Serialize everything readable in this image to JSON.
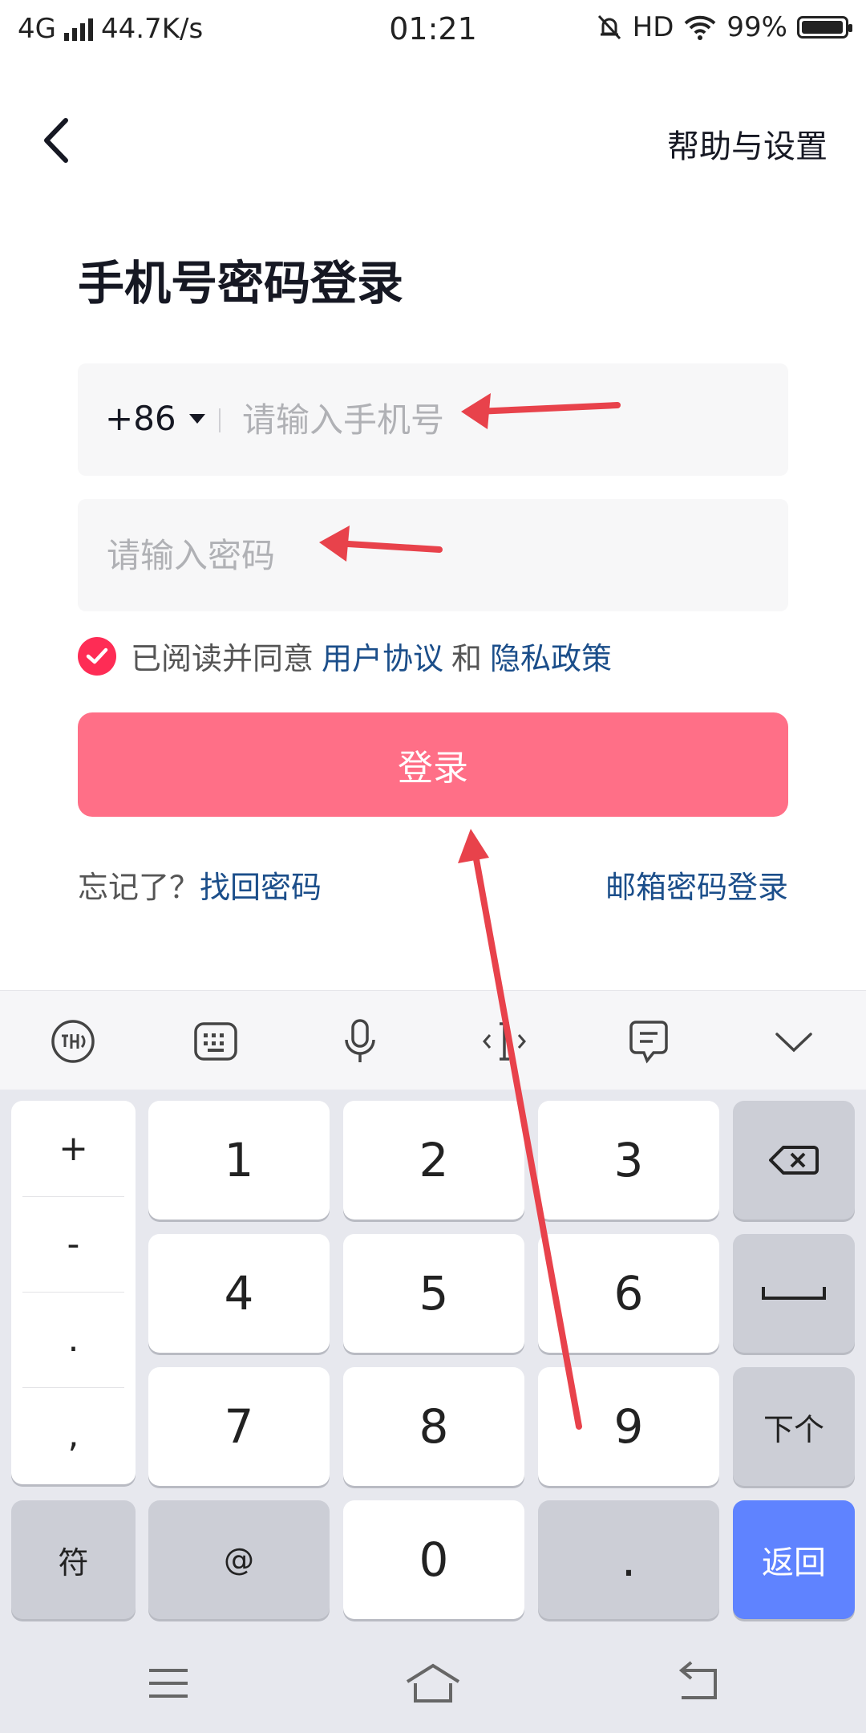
{
  "status_bar": {
    "network": "4G",
    "speed": "44.7K/s",
    "time": "01:21",
    "hd": "HD",
    "battery": "99%",
    "battery_level": 0.99
  },
  "header": {
    "help_label": "帮助与设置"
  },
  "page_title": "手机号密码登录",
  "phone": {
    "country_code": "+86",
    "placeholder": "请输入手机号"
  },
  "password": {
    "placeholder": "请输入密码"
  },
  "agreement": {
    "text": "已阅读并同意",
    "user_agreement": "用户协议",
    "and": "和",
    "privacy_policy": "隐私政策",
    "checked": true
  },
  "login_button": "登录",
  "forgot": {
    "prefix": "忘记了？",
    "link": "找回密码"
  },
  "email_login": "邮箱密码登录",
  "keyboard": {
    "symbols": [
      "+",
      "-",
      ".",
      ","
    ],
    "digits": [
      "1",
      "2",
      "3",
      "4",
      "5",
      "6",
      "7",
      "8",
      "9",
      "0"
    ],
    "fu_label": "符",
    "at_label": "@",
    "dot_label": ".",
    "next_label": "下个",
    "return_label": "返回"
  },
  "colors": {
    "accent": "#fe2c55",
    "login_button": "#ff6f87",
    "link": "#1b4e8a",
    "return_key": "#5f83ff",
    "annotation_arrow": "#e8424b"
  }
}
